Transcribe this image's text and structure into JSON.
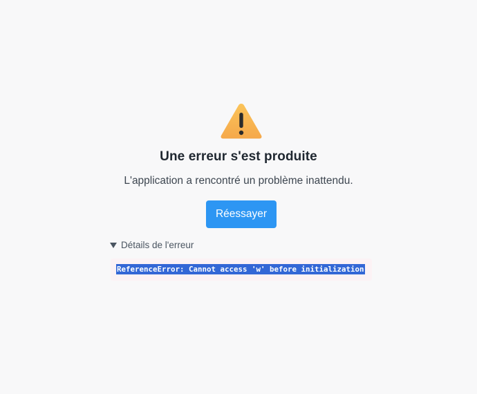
{
  "error_page": {
    "icon": "warning-triangle-icon",
    "title": "Une erreur s'est produite",
    "message": "L'application a rencontré un problème inattendu.",
    "retry_label": "Réessayer",
    "details_label": "Détails de l'erreur",
    "details_expanded": true,
    "error_text": "ReferenceError: Cannot access 'w' before initialization"
  },
  "colors": {
    "background": "#f8f8f9",
    "accent": "#2d96f3",
    "warning": "#f7b24a",
    "error_box_bg": "#fcf2f5",
    "selection": "#3367d6"
  }
}
